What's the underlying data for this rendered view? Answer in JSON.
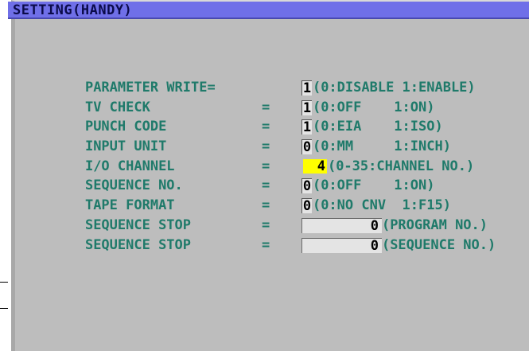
{
  "title": "SETTING(HANDY)",
  "rows": [
    {
      "label": "PARAMETER WRITE=",
      "eq": "",
      "value": "1",
      "desc": "(0:DISABLE 1:ENABLE)"
    },
    {
      "label": "TV CHECK",
      "eq": "=",
      "value": "1",
      "desc": "(0:OFF    1:ON)"
    },
    {
      "label": "PUNCH CODE",
      "eq": "=",
      "value": "1",
      "desc": "(0:EIA    1:ISO)"
    },
    {
      "label": "INPUT UNIT",
      "eq": "=",
      "value": "0",
      "desc": "(0:MM     1:INCH)"
    },
    {
      "label": "I/O CHANNEL",
      "eq": "=",
      "value": "4",
      "desc": "(0-35:CHANNEL NO.)"
    },
    {
      "label": "SEQUENCE NO.",
      "eq": "=",
      "value": "0",
      "desc": "(0:OFF    1:ON)"
    },
    {
      "label": "TAPE FORMAT",
      "eq": "=",
      "value": "0",
      "desc": "(0:NO CNV  1:F15)"
    },
    {
      "label": "SEQUENCE STOP",
      "eq": "=",
      "value": "0",
      "desc": "(PROGRAM NO.)"
    },
    {
      "label": "SEQUENCE STOP",
      "eq": "=",
      "value": "0",
      "desc": "(SEQUENCE NO.)"
    }
  ]
}
